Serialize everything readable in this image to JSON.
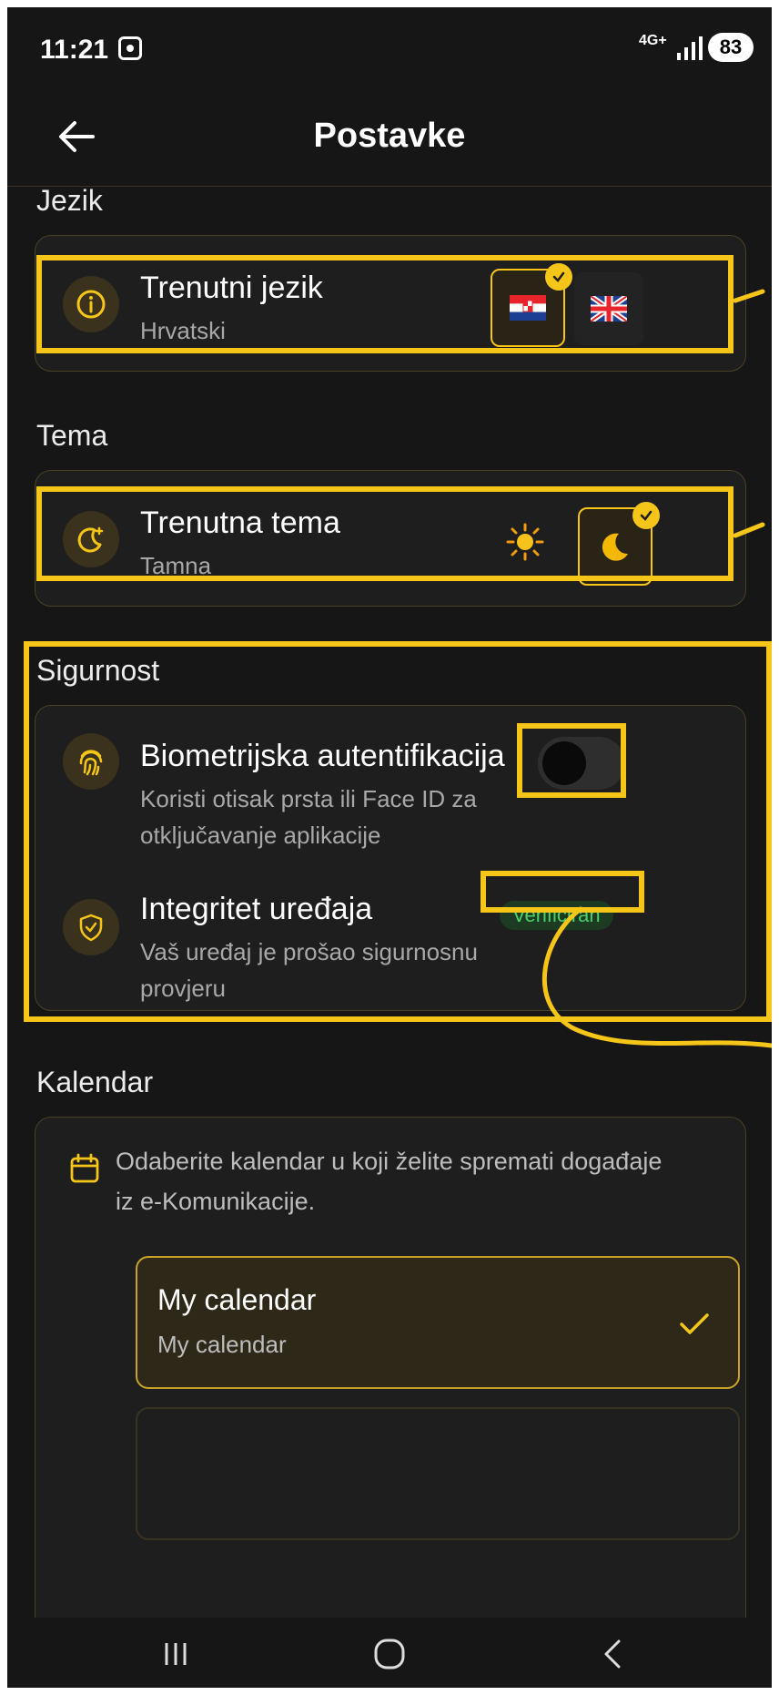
{
  "status_bar": {
    "time": "11:21",
    "network": "4G+",
    "battery": "83",
    "screenshot_icon": "screenshot-icon"
  },
  "app_bar": {
    "title": "Postavke",
    "back_icon": "arrow-left-icon"
  },
  "language": {
    "section_title": "Jezik",
    "row_title": "Trenutni jezik",
    "row_value": "Hrvatski",
    "options": [
      {
        "flag": "croatia-flag-icon",
        "selected": true
      },
      {
        "flag": "uk-flag-icon",
        "selected": false
      }
    ]
  },
  "theme": {
    "section_title": "Tema",
    "row_title": "Trenutna tema",
    "row_value": "Tamna",
    "options": [
      {
        "icon": "sun-icon",
        "selected": false
      },
      {
        "icon": "moon-icon",
        "selected": true
      }
    ]
  },
  "security": {
    "section_title": "Sigurnost",
    "biometric": {
      "title": "Biometrijska autentifikacija",
      "description": "Koristi otisak prsta ili Face ID za otključavanje aplikacije",
      "enabled": false
    },
    "integrity": {
      "title": "Integritet uređaja",
      "description": "Vaš uređaj je prošao sigurnosnu provjeru",
      "badge": "Verificiran"
    }
  },
  "calendar": {
    "section_title": "Kalendar",
    "description": "Odaberite kalendar u koji želite spremati događaje iz e-Komunikacije.",
    "options": [
      {
        "name": "My calendar",
        "account": "My calendar",
        "selected": true
      }
    ]
  },
  "colors": {
    "accent": "#f5c518",
    "background": "#161616",
    "card": "#1e1e1e",
    "verified": "#4bd16a"
  }
}
